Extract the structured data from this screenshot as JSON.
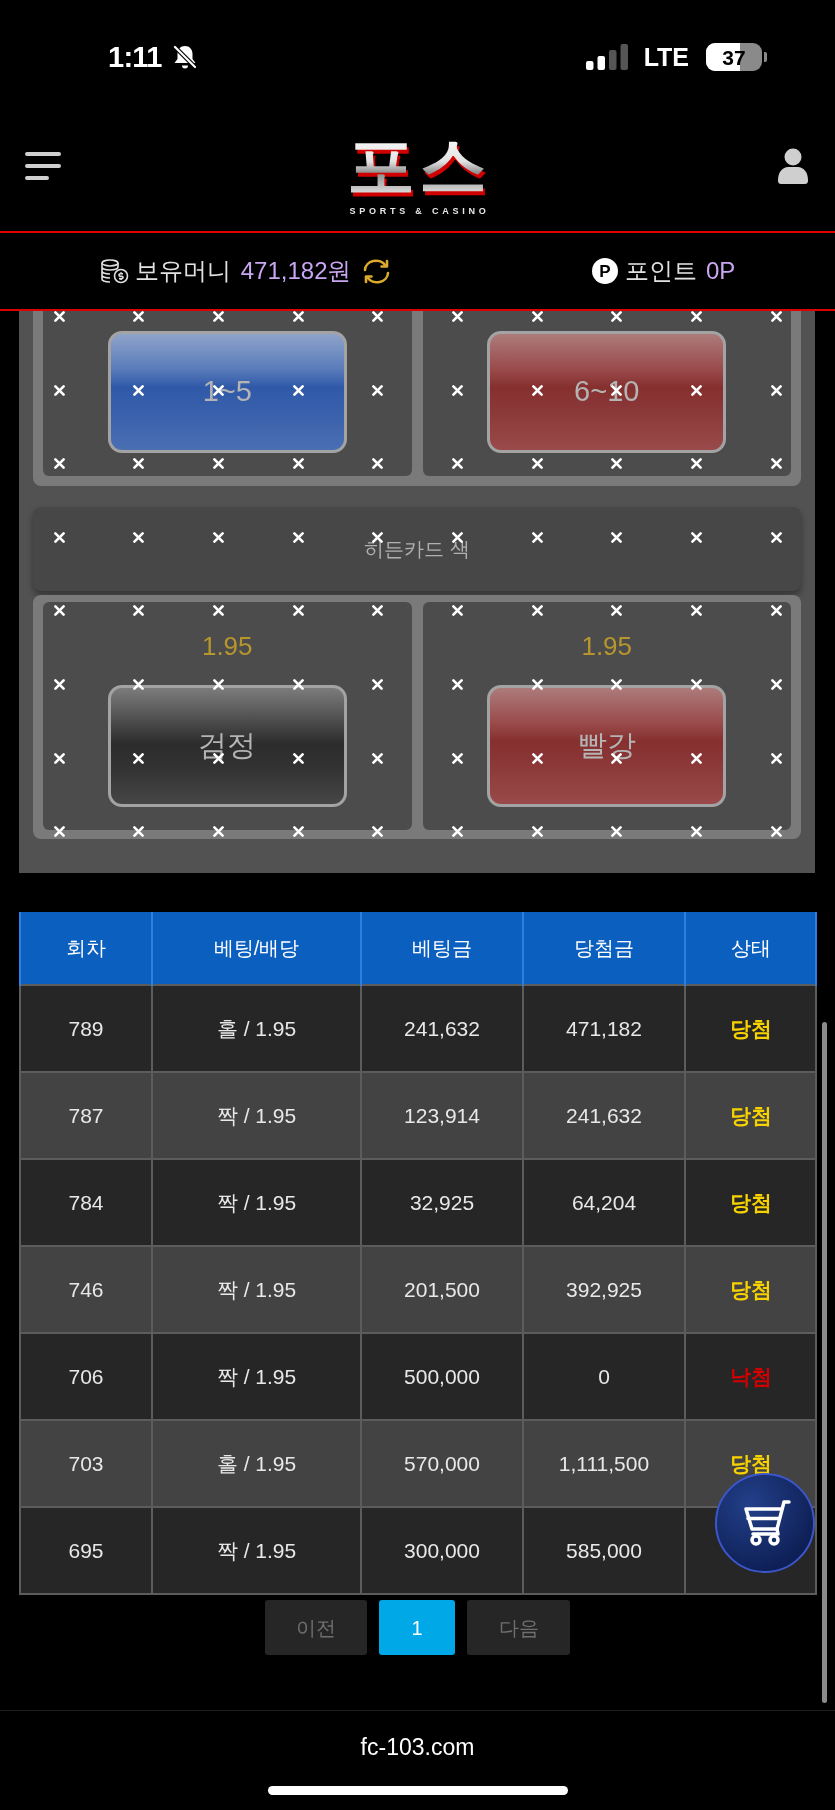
{
  "status_bar": {
    "time": "1:11",
    "silent": true,
    "network": "LTE",
    "battery": "37"
  },
  "header": {
    "logo_text": "포스",
    "logo_tagline": "SPORTS & CASINO"
  },
  "wallet": {
    "balance_label": "보유머니",
    "balance": "471,182원",
    "points_badge": "P",
    "points_label": "포인트",
    "points": "0P"
  },
  "bet_panel": {
    "closed": true,
    "groups": [
      {
        "options": [
          {
            "label": "1~5",
            "kind": "blue"
          },
          {
            "label": "6~10",
            "kind": "red"
          }
        ]
      },
      {
        "title": "히든카드 색",
        "options": [
          {
            "odds": "1.95",
            "label": "검정",
            "kind": "black"
          },
          {
            "odds": "1.95",
            "label": "빨강",
            "kind": "red"
          }
        ]
      }
    ]
  },
  "bet_history": {
    "columns": [
      "회차",
      "베팅/배당",
      "베팅금",
      "당첨금",
      "상태"
    ],
    "rows": [
      {
        "round": "789",
        "pick": "홀 / 1.95",
        "stake": "241,632",
        "payout": "471,182",
        "status": "당첨",
        "won": true
      },
      {
        "round": "787",
        "pick": "짝 / 1.95",
        "stake": "123,914",
        "payout": "241,632",
        "status": "당첨",
        "won": true
      },
      {
        "round": "784",
        "pick": "짝 / 1.95",
        "stake": "32,925",
        "payout": "64,204",
        "status": "당첨",
        "won": true
      },
      {
        "round": "746",
        "pick": "짝 / 1.95",
        "stake": "201,500",
        "payout": "392,925",
        "status": "당첨",
        "won": true
      },
      {
        "round": "706",
        "pick": "짝 / 1.95",
        "stake": "500,000",
        "payout": "0",
        "status": "낙첨",
        "won": false
      },
      {
        "round": "703",
        "pick": "홀 / 1.95",
        "stake": "570,000",
        "payout": "1,111,500",
        "status": "당첨",
        "won": true
      },
      {
        "round": "695",
        "pick": "짝 / 1.95",
        "stake": "300,000",
        "payout": "585,000"
      }
    ]
  },
  "pagination": {
    "previous": "이전",
    "pages": [
      {
        "label": "1",
        "selected": true
      }
    ],
    "next": "다음"
  },
  "browser": {
    "url": "fc-103.com"
  }
}
